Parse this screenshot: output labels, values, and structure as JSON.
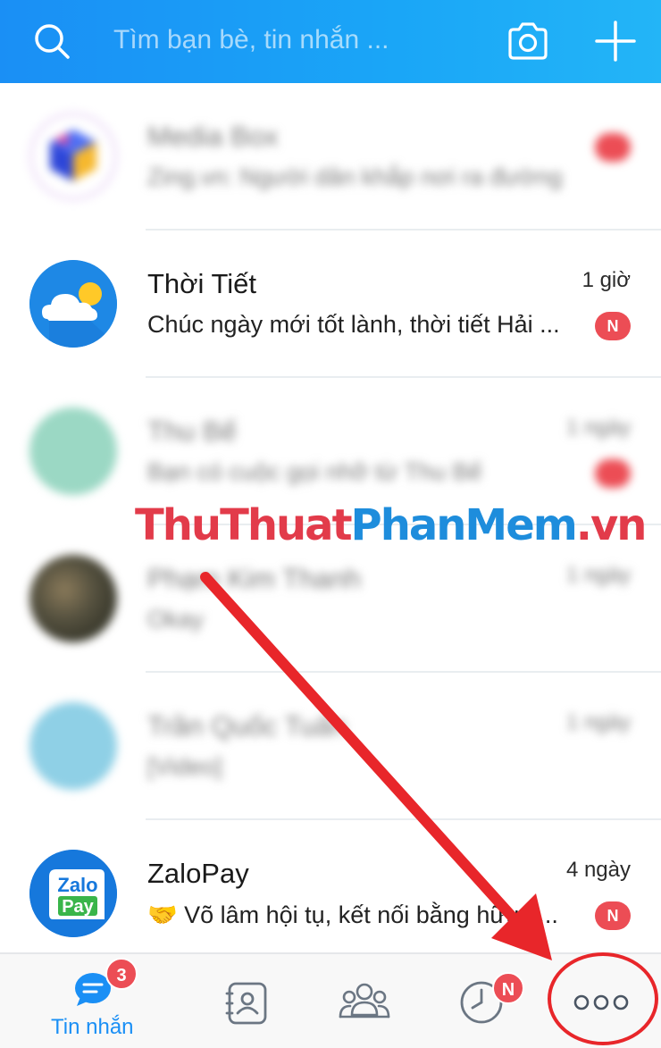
{
  "header": {
    "search_placeholder": "Tìm bạn bè, tin nhắn ..."
  },
  "conversations": [
    {
      "name": "Media Box",
      "preview": "Zing.vn: Người dân khắp nơi ra đường",
      "time": "",
      "badge": "",
      "blurred": true
    },
    {
      "name": "Thời Tiết",
      "preview": "Chúc ngày mới tốt lành, thời tiết Hải ...",
      "time": "1 giờ",
      "badge": "N",
      "blurred": false
    },
    {
      "name": "Thu Bế",
      "preview": "Bạn có cuộc gọi nhỡ từ Thu Bế",
      "time": "1 ngày",
      "badge": "",
      "blurred": true
    },
    {
      "name": "Phạm Kim Thanh",
      "preview": "Okay",
      "time": "1 ngày",
      "badge": "",
      "blurred": true
    },
    {
      "name": "Trần Quốc Tuấn",
      "preview": "[Video]",
      "time": "1 ngày",
      "badge": "",
      "blurred": true
    },
    {
      "name": "ZaloPay",
      "preview": "🤝 Võ lâm hội tụ, kết nối bằng hữu, l...",
      "time": "4 ngày",
      "badge": "N",
      "blurred": false
    }
  ],
  "watermark": {
    "part1": "ThuThuat",
    "part2": "PhanMem",
    "part3": ".vn"
  },
  "bottom_nav": {
    "messages_label": "Tin nhắn",
    "messages_badge": "3",
    "timeline_badge": "N",
    "more_label": "ooo"
  },
  "colors": {
    "accent": "#1a8ff5",
    "badge": "#ec4d55",
    "annotation": "#e8262a"
  }
}
